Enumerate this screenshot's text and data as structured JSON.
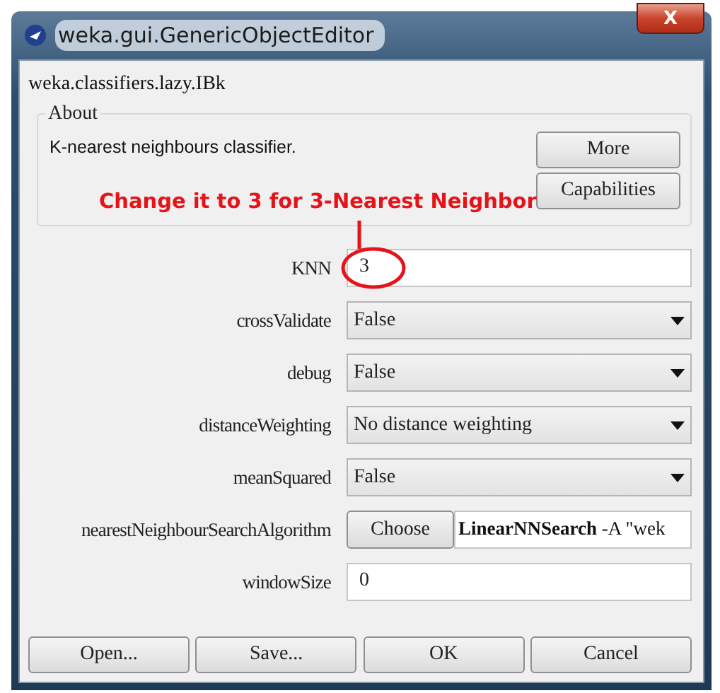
{
  "window": {
    "title": "weka.gui.GenericObjectEditor",
    "close": "X"
  },
  "class_name": "weka.classifiers.lazy.IBk",
  "about": {
    "legend": "About",
    "text": "K-nearest neighbours classifier.",
    "buttons": [
      "More",
      "Capabilities"
    ]
  },
  "annotation": {
    "text": "Change it to 3 for 3-Nearest Neighbor"
  },
  "properties": [
    {
      "label": "KNN",
      "kind": "text",
      "value": "3",
      "highlighted": true
    },
    {
      "label": "crossValidate",
      "kind": "dropdown",
      "value": "False"
    },
    {
      "label": "debug",
      "kind": "dropdown",
      "value": "False"
    },
    {
      "label": "distanceWeighting",
      "kind": "dropdown",
      "value": "No distance weighting"
    },
    {
      "label": "meanSquared",
      "kind": "dropdown",
      "value": "False"
    },
    {
      "label": "nearestNeighbourSearchAlgorithm",
      "kind": "chooser",
      "button": "Choose",
      "value": "**LinearNNSearch** -A \"wek"
    },
    {
      "label": "windowSize",
      "kind": "text",
      "value": "0"
    }
  ],
  "buttons": [
    "Open...",
    "Save...",
    "OK",
    "Cancel"
  ]
}
